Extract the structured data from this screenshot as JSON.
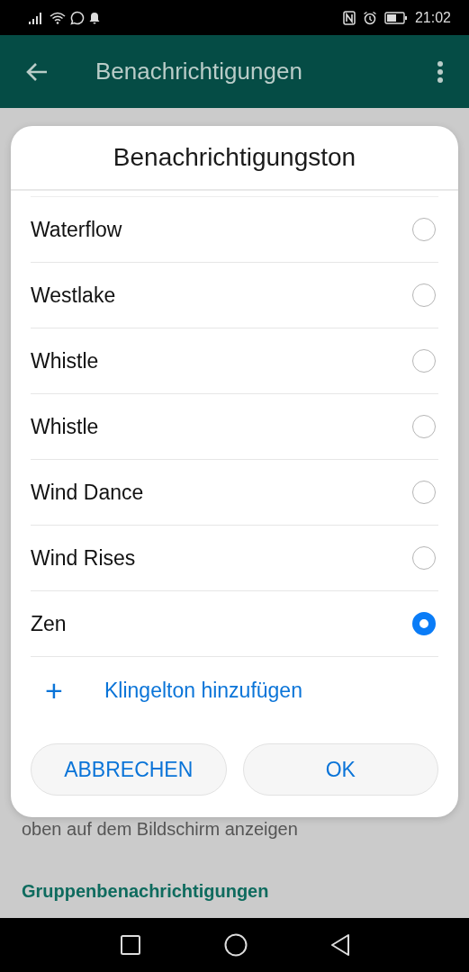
{
  "status_bar": {
    "time": "21:02"
  },
  "app_bar": {
    "title": "Benachrichtigungen"
  },
  "background": {
    "description": "oben auf dem Bildschirm anzeigen",
    "section_header": "Gruppenbenachrichtigungen"
  },
  "dialog": {
    "title": "Benachrichtigungston",
    "options": [
      {
        "label": "Waterflow",
        "selected": false
      },
      {
        "label": "Westlake",
        "selected": false
      },
      {
        "label": "Whistle",
        "selected": false
      },
      {
        "label": "Whistle",
        "selected": false
      },
      {
        "label": "Wind Dance",
        "selected": false
      },
      {
        "label": "Wind Rises",
        "selected": false
      },
      {
        "label": "Zen",
        "selected": true
      }
    ],
    "add_action": {
      "icon": "+",
      "label": "Klingelton hinzufügen"
    },
    "buttons": [
      "ABBRECHEN",
      "OK"
    ]
  }
}
